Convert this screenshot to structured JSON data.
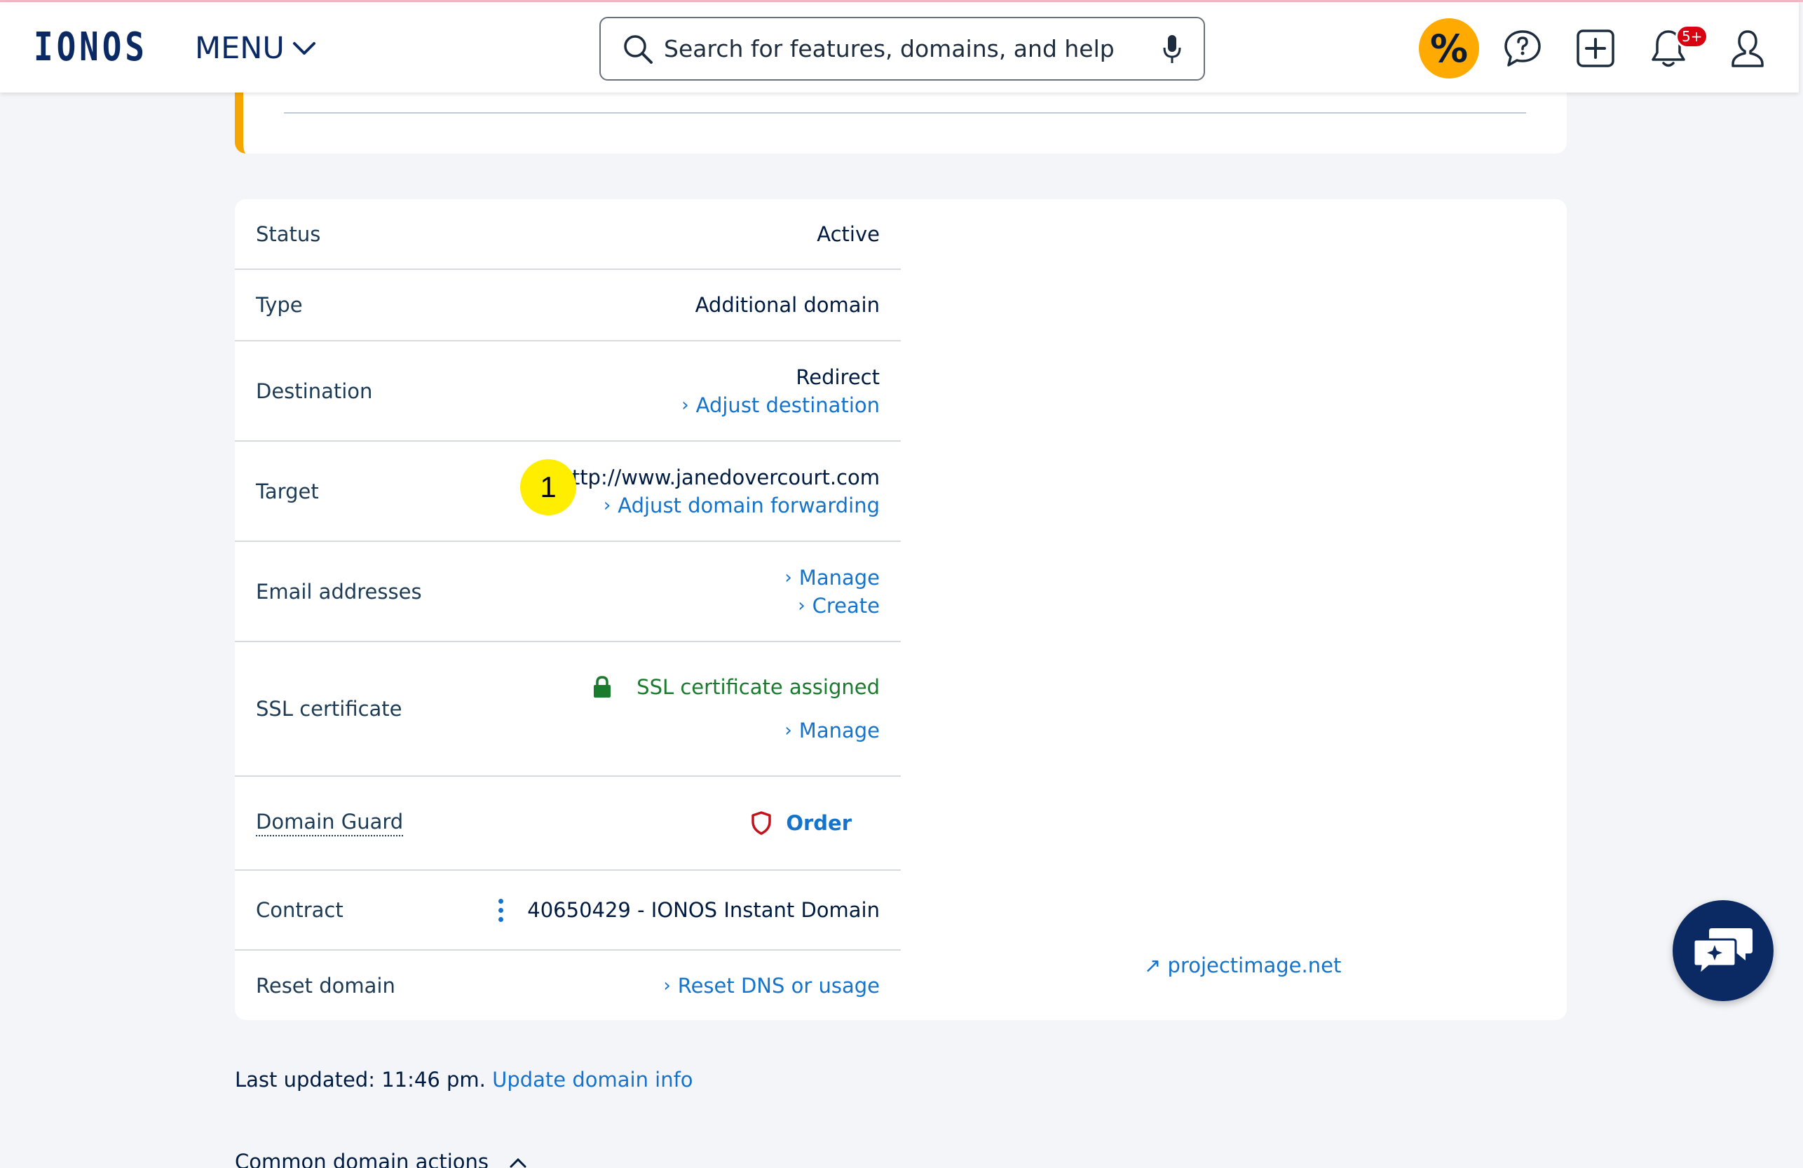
{
  "header": {
    "logo_text": "IONOS",
    "menu_label": "MENU",
    "search_placeholder": "Search for features, domains, and help",
    "deals_symbol": "%",
    "notifications_count": "5+"
  },
  "details": {
    "status": {
      "label": "Status",
      "value": "Active"
    },
    "type": {
      "label": "Type",
      "value": "Additional domain"
    },
    "destination": {
      "label": "Destination",
      "value": "Redirect",
      "action": "Adjust destination"
    },
    "target": {
      "label": "Target",
      "value": "http://www.janedovercourt.com",
      "action": "Adjust domain forwarding",
      "marker": "1"
    },
    "email": {
      "label": "Email addresses",
      "action1": "Manage",
      "action2": "Create"
    },
    "ssl": {
      "label": "SSL certificate",
      "value": "SSL certificate assigned",
      "action": "Manage"
    },
    "guard": {
      "label": "Domain Guard",
      "action": "Order"
    },
    "contract": {
      "label": "Contract",
      "value": "40650429 - IONOS Instant Domain"
    },
    "reset": {
      "label": "Reset domain",
      "action": "Reset DNS or usage"
    }
  },
  "external_link": "projectimage.net",
  "footer": {
    "last_updated": "Last updated: 11:46 pm.",
    "update_link": "Update domain info",
    "common_actions": "Common domain actions"
  },
  "colors": {
    "brand": "#0b2a63",
    "link": "#1473cc",
    "accent": "#ffaa00",
    "success": "#1a7a2e",
    "danger": "#c4121d"
  }
}
